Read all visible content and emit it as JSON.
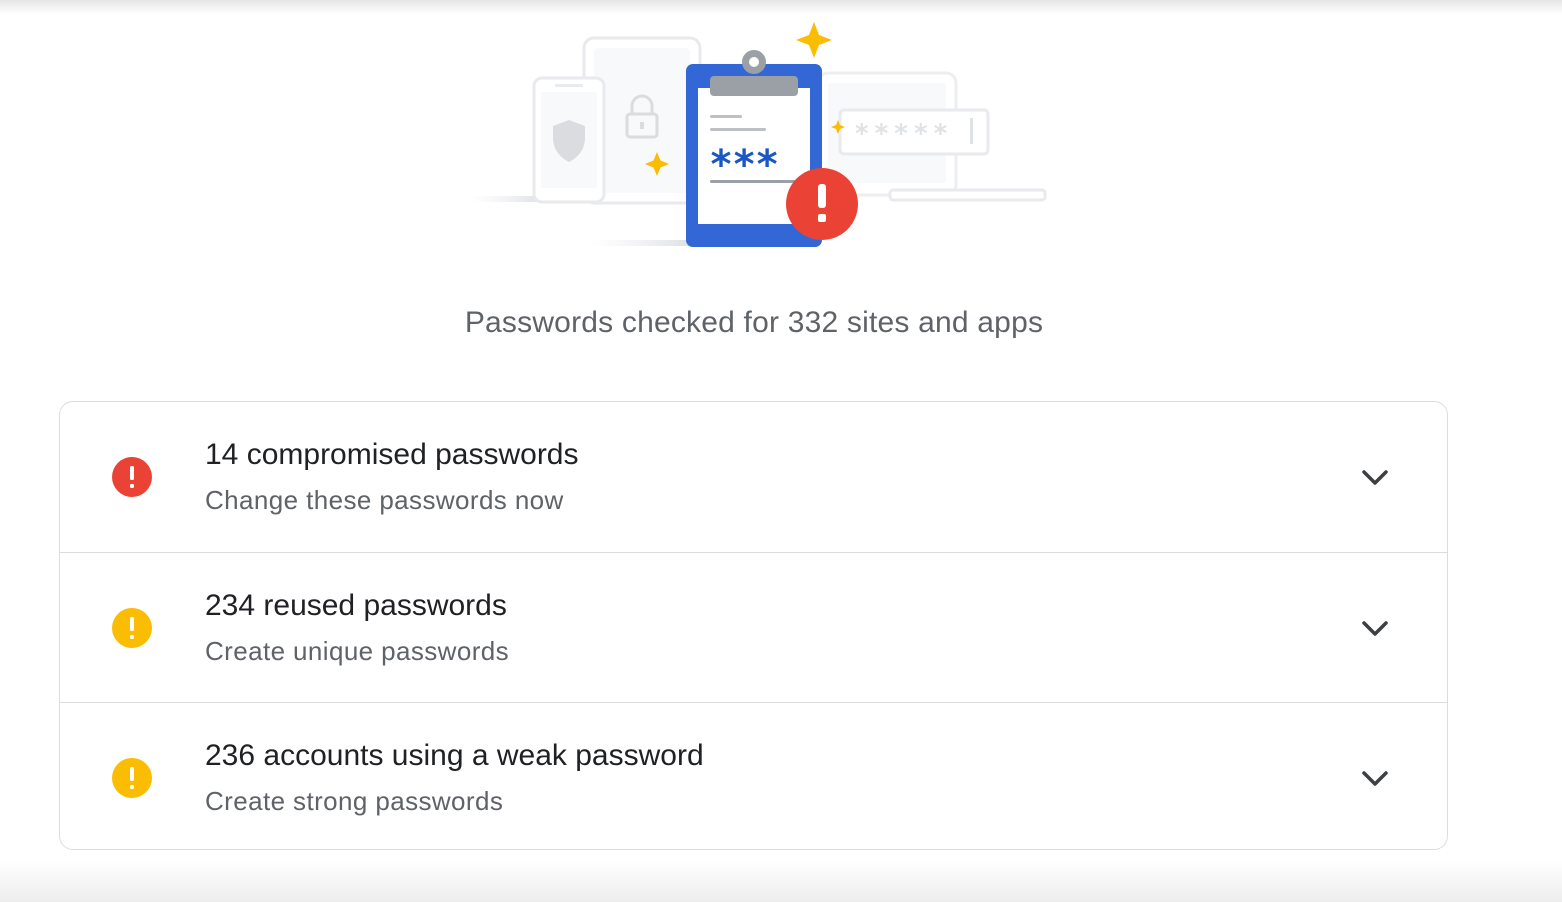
{
  "summary": {
    "text": "Passwords checked for 332 sites and apps"
  },
  "illustration": {
    "masked_field_text": "*****",
    "clipboard_password": "***",
    "alert_glyph": "!"
  },
  "issues": [
    {
      "title": "14 compromised passwords",
      "subtitle": "Change these passwords now",
      "severity": "error",
      "icon": "error-icon",
      "icon_color": "#ea4335",
      "expand_icon": "chevron-down-icon"
    },
    {
      "title": "234 reused passwords",
      "subtitle": "Create unique passwords",
      "severity": "warning",
      "icon": "warning-icon",
      "icon_color": "#fbbc04",
      "expand_icon": "chevron-down-icon"
    },
    {
      "title": "236 accounts using a weak password",
      "subtitle": "Create strong passwords",
      "severity": "warning",
      "icon": "warning-icon",
      "icon_color": "#fbbc04",
      "expand_icon": "chevron-down-icon"
    }
  ],
  "colors": {
    "accent_blue": "#3367d6",
    "error_red": "#ea4335",
    "warning_yellow": "#fbbc04",
    "sparkle_yellow": "#fbbc04",
    "border": "#dadce0",
    "text_primary": "#202124",
    "text_secondary": "#5f6368"
  }
}
